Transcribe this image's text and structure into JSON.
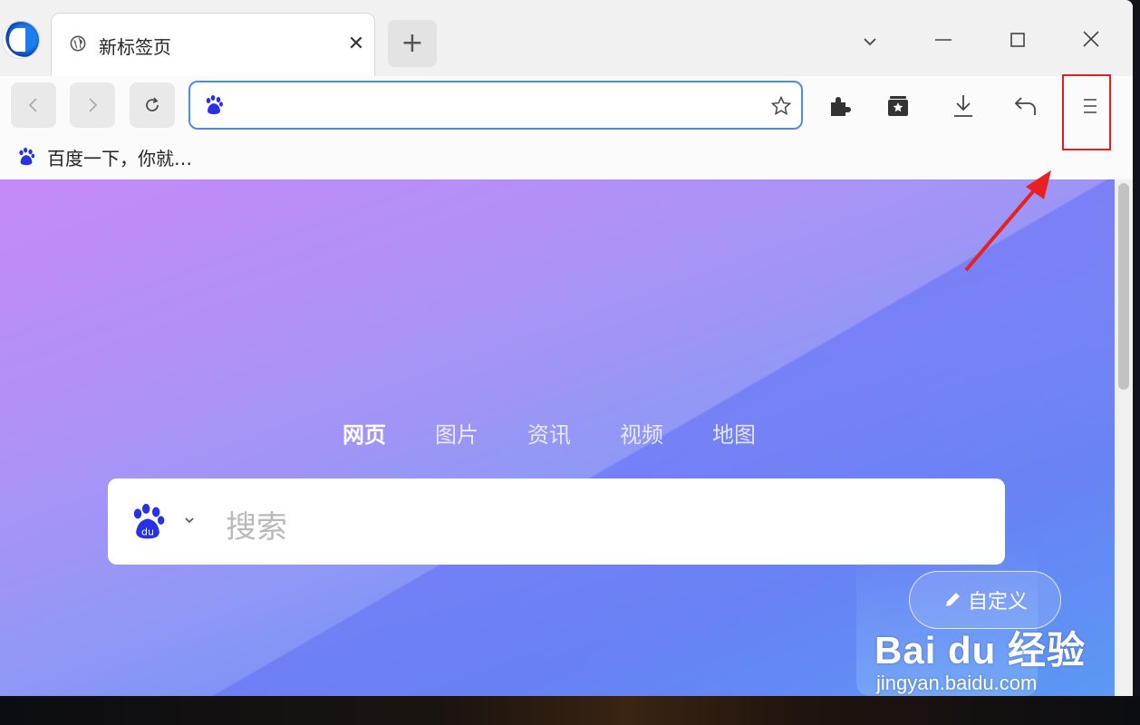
{
  "tab": {
    "title": "新标签页",
    "close_glyph": "✕"
  },
  "newtab_glyph": "+",
  "omnibox": {
    "value": "",
    "placeholder": ""
  },
  "bookmarks": [
    {
      "label": "百度一下，你就…",
      "icon": "baidu-paw-icon"
    }
  ],
  "search_tabs": [
    {
      "label": "网页",
      "active": true
    },
    {
      "label": "图片",
      "active": false
    },
    {
      "label": "资讯",
      "active": false
    },
    {
      "label": "视频",
      "active": false
    },
    {
      "label": "地图",
      "active": false
    }
  ],
  "search": {
    "placeholder": "搜索"
  },
  "customize_label": "自定义",
  "watermark": {
    "brand": "Bai du 经验",
    "url": "jingyan.baidu.com"
  },
  "colors": {
    "accent": "#4d8af0",
    "baidu_blue": "#2932e1",
    "highlight_red": "#e02020"
  }
}
